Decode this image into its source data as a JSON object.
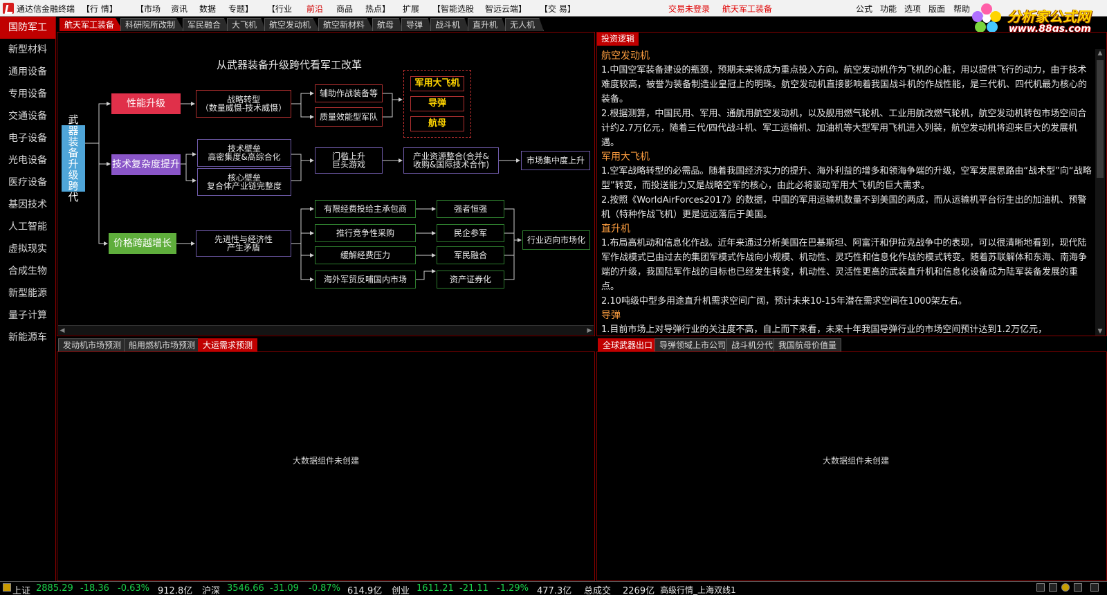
{
  "app": {
    "title": "通达信金融终端",
    "menu": [
      "【行 情】",
      "【市场",
      "资讯",
      "数据",
      "专题】",
      "【行业",
      "前沿",
      "商品",
      "热点】",
      "扩展",
      "【智能选股",
      "智远云端】",
      "【交 易】"
    ],
    "active_menu": "前沿",
    "login_status": "交易未登录",
    "current_board": "航天军工装备",
    "right_menu": [
      "公式",
      "功能",
      "选项",
      "版面",
      "帮助"
    ],
    "brand_name": "分析家公式网",
    "brand_url": "www.88gs.com"
  },
  "sidebar": {
    "items": [
      "国防军工",
      "新型材料",
      "通用设备",
      "专用设备",
      "交通设备",
      "电子设备",
      "光电设备",
      "医疗设备",
      "基因技术",
      "人工智能",
      "虚拟现实",
      "合成生物",
      "新型能源",
      "量子计算",
      "新能源车"
    ],
    "active": "国防军工"
  },
  "top_tabs": [
    "航天军工装备",
    "科研院所改制",
    "军民融合",
    "大飞机",
    "航空发动机",
    "航空新材料",
    "航母",
    "导弹",
    "战斗机",
    "直升机",
    "无人机"
  ],
  "top_tabs_active": "航天军工装备",
  "diagram": {
    "title": "从武器装备升级跨代看军工改革",
    "root": "武器装备升级跨代",
    "level1": [
      "性能升级",
      "技术复杂度提升",
      "价格跨越增长"
    ],
    "n_strategy": "战略转型\n（数量威慑-技术威慑）",
    "n_assist": "辅助作战装备等",
    "n_quality": "质量效能型军队",
    "n_plane": "军用大飞机",
    "n_missile": "导弹",
    "n_carrier": "航母",
    "n_tech": "技术壁垒\n高密集度&高综合化",
    "n_core": "核心壁垒\n复合体产业链完整度",
    "n_barrier": "门槛上升\n巨头游戏",
    "n_merge": "产业资源整合(合并&\n收购&国际技术合作)",
    "n_conc": "市场集中度上升",
    "n_adv": "先进性与经济性\n产生矛盾",
    "n_fund": "有限经费投给主承包商",
    "n_comp": "推行竞争性采购",
    "n_ease": "缓解经费压力",
    "n_trade": "海外军贸反哺国内市场",
    "n_strong": "强者恒强",
    "n_private": "民企参军",
    "n_civil": "军民融合",
    "n_sec": "资产证券化",
    "n_market": "行业迈向市场化"
  },
  "logic": {
    "header": "投资逻辑",
    "sections": [
      {
        "title": "航空发动机",
        "paras": [
          "1.中国空军装备建设的瓶颈，预期未来将成为重点投入方向。航空发动机作为飞机的心脏，用以提供飞行的动力，由于技术难度较高，被誉为装备制造业皇冠上的明珠。航空发动机直接影响着我国战斗机的作战性能，是三代机、四代机最为核心的装备。",
          "2.根据测算，中国民用、军用、通航用航空发动机，以及舰用燃气轮机、工业用航改燃气轮机，航空发动机转包市场空间合计约2.7万亿元，随着三代/四代战斗机、军工运输机、加油机等大型军用飞机进入列装，航空发动机将迎来巨大的发展机遇。"
        ]
      },
      {
        "title": "军用大飞机",
        "paras": [
          "1.空军战略转型的必需品。随着我国经济实力的提升、海外利益的增多和领海争端的升级，空军发展思路由“战术型”向“战略型”转变，而投送能力又是战略空军的核心，由此必将驱动军用大飞机的巨大需求。",
          "2.按照《WorldAirForces2017》的数据，中国的军用运输机数量不到美国的两成，而从运输机平台衍生出的加油机、预警机（特种作战飞机）更是远远落后于美国。"
        ]
      },
      {
        "title": "直升机",
        "paras": [
          "1.布局高机动和信息化作战。近年来通过分析美国在巴基斯坦、阿富汗和伊拉克战争中的表现，可以很清晰地看到，现代陆军作战模式已由过去的集团军模式作战向小规模、机动性、灵巧性和信息化作战的模式转变。随着苏联解体和东海、南海争端的升级，我国陆军作战的目标也已经发生转变，机动性、灵活性更高的武装直升机和信息化设备成为陆军装备发展的重点。",
          "2.10吨级中型多用途直升机需求空间广阔，预计未来10-15年潜在需求空间在1000架左右。"
        ]
      },
      {
        "title": "导弹",
        "paras": [
          "1.目前市场上对导弹行业的关注度不高，自上而下来看，未来十年我国导弹行业的市场空间预计达到1.2万亿元，"
        ]
      }
    ]
  },
  "bottom_left": {
    "tabs": [
      "发动机市场预测",
      "船用燃机市场预测",
      "大运需求预测"
    ],
    "active": "大运需求预测",
    "placeholder": "大数据组件未创建"
  },
  "bottom_right": {
    "tabs": [
      "全球武器出口",
      "导弹领域上市公司",
      "战斗机分代",
      "我国航母价值量"
    ],
    "active": "全球武器出口",
    "placeholder": "大数据组件未创建"
  },
  "status": {
    "sh_label": "上证",
    "sh_val": "2885.29",
    "sh_chg": "-18.36",
    "sh_pct": "-0.63%",
    "sh_amt": "912.8亿",
    "sz_label": "沪深",
    "sz_val": "3546.66",
    "sz_chg": "-31.09",
    "sz_pct": "-0.87%",
    "sz_amt": "614.9亿",
    "cy_label": "创业",
    "cy_val": "1611.21",
    "cy_chg": "-21.11",
    "cy_pct": "-1.29%",
    "cy_amt": "477.3亿",
    "total_label": "总成交",
    "total_amt": "2269亿",
    "feed": "高级行情_上海双线1",
    "colors": {
      "down": "#19d44b",
      "accent": "#c00000"
    }
  }
}
